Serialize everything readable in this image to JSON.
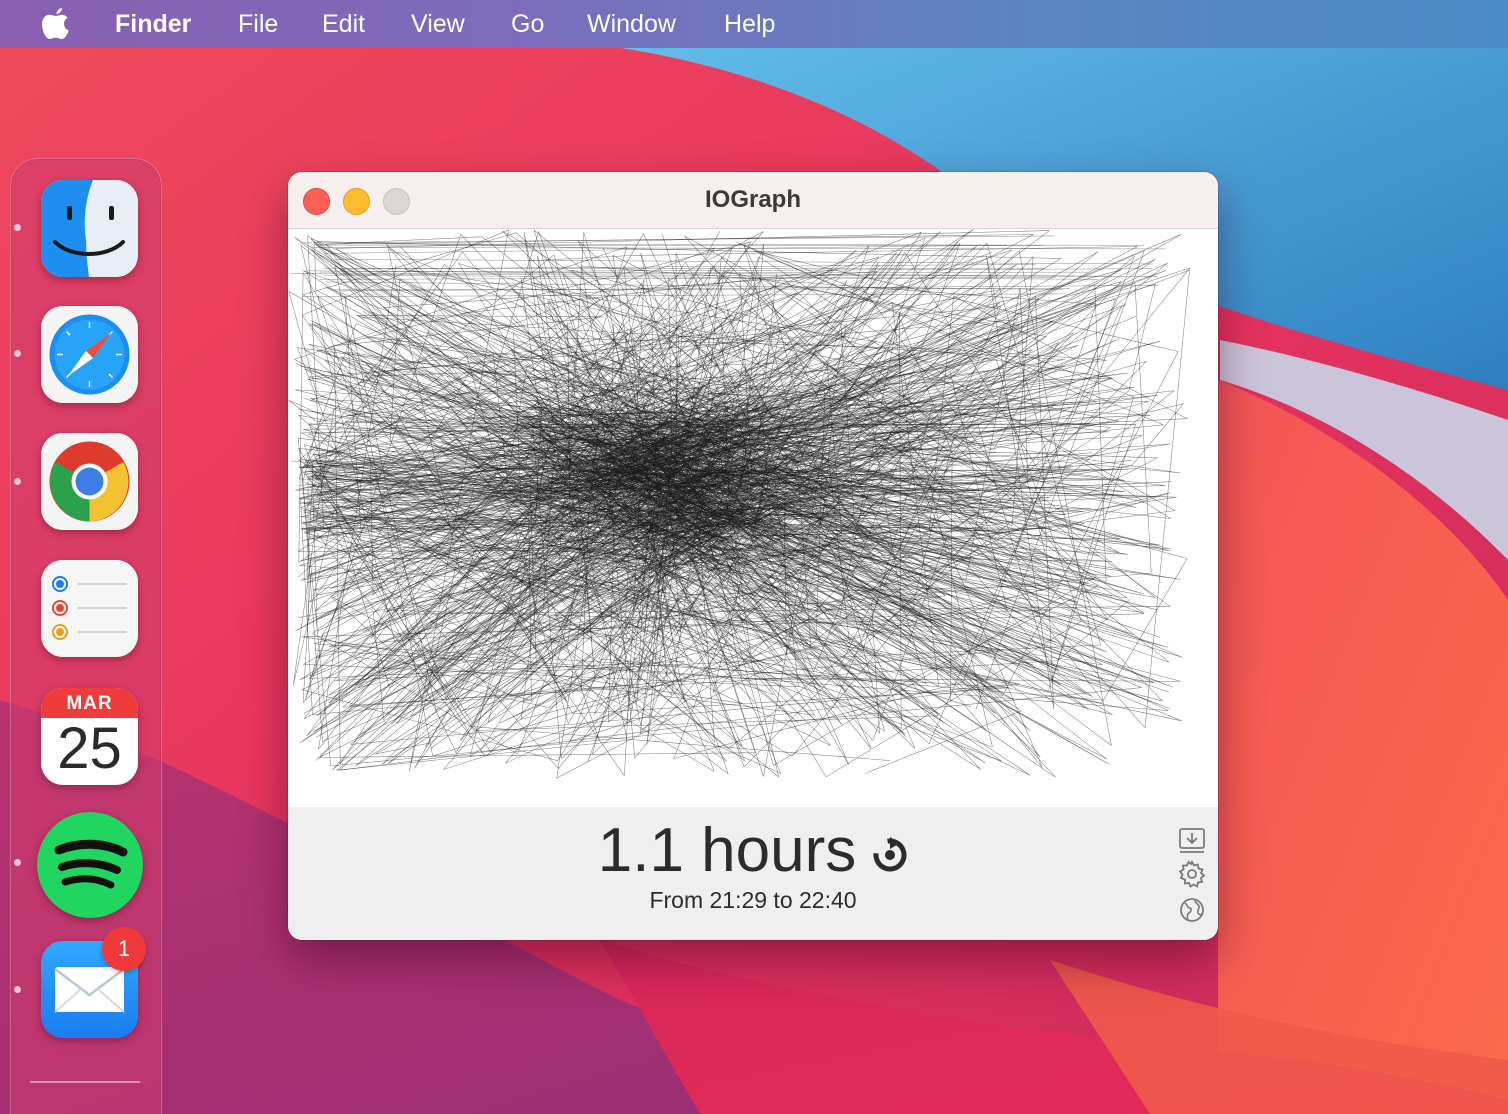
{
  "menubar": {
    "apple_icon": "apple-logo-icon",
    "items": [
      {
        "label": "Finder",
        "bold": true
      },
      {
        "label": "File"
      },
      {
        "label": "Edit"
      },
      {
        "label": "View"
      },
      {
        "label": "Go"
      },
      {
        "label": "Window"
      },
      {
        "label": "Help"
      }
    ]
  },
  "dock": {
    "apps": [
      {
        "name": "Finder",
        "icon": "finder-icon",
        "running": true
      },
      {
        "name": "Safari",
        "icon": "safari-icon",
        "running": true
      },
      {
        "name": "Chrome",
        "icon": "chrome-icon",
        "running": true
      },
      {
        "name": "Reminders",
        "icon": "reminders-icon",
        "running": false
      },
      {
        "name": "Calendar",
        "icon": "calendar-icon",
        "running": false,
        "month": "MAR",
        "day": "25"
      },
      {
        "name": "Spotify",
        "icon": "spotify-icon",
        "running": true
      },
      {
        "name": "Mail",
        "icon": "mail-icon",
        "running": true,
        "badge": "1"
      }
    ]
  },
  "window": {
    "title": "IOGraph",
    "duration": "1.1 hours",
    "range": "From 21:29 to 22:40",
    "tools": [
      {
        "icon": "save-download-icon"
      },
      {
        "icon": "gear-icon"
      },
      {
        "icon": "globe-icon"
      }
    ],
    "reset_icon": "reset-icon"
  },
  "colors": {
    "close": "#fe5f57",
    "minimize": "#febc2e",
    "zoom": "#dcd6d6",
    "trace": "#1a1a1a"
  }
}
